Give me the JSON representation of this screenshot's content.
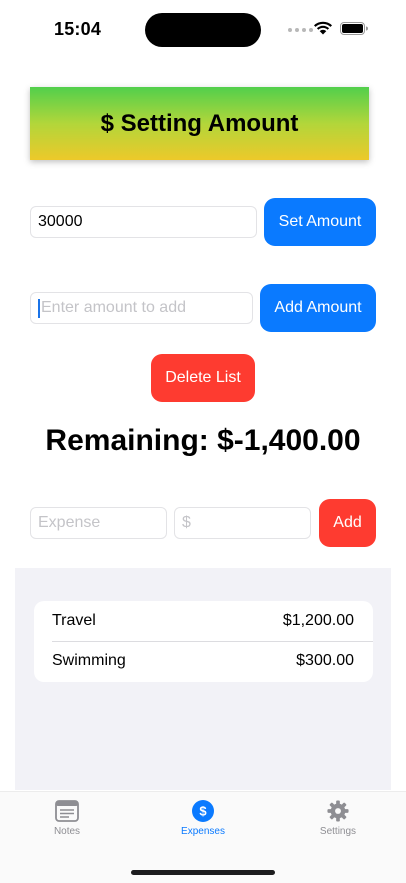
{
  "status_bar": {
    "time": "15:04"
  },
  "header": {
    "title": "$ Setting Amount"
  },
  "budget": {
    "value": "30000",
    "set_label": "Set Amount"
  },
  "add_amount": {
    "placeholder": "Enter amount to add",
    "button_label": "Add Amount"
  },
  "delete_label": "Delete List",
  "remaining": "Remaining: $-1,400.00",
  "new_expense": {
    "name_placeholder": "Expense",
    "amount_placeholder": "$",
    "add_label": "Add"
  },
  "expenses": [
    {
      "name": "Travel",
      "amount": "$1,200.00"
    },
    {
      "name": "Swimming",
      "amount": "$300.00"
    }
  ],
  "tabs": [
    {
      "label": "Notes",
      "icon": "notes-icon",
      "active": false
    },
    {
      "label": "Expenses",
      "icon": "dollar-icon",
      "active": true
    },
    {
      "label": "Settings",
      "icon": "gear-icon",
      "active": false
    }
  ],
  "colors": {
    "accent": "#0a7aff",
    "danger": "#fe3b30",
    "banner_top": "#52cf4c",
    "banner_bottom": "#edc92a"
  }
}
